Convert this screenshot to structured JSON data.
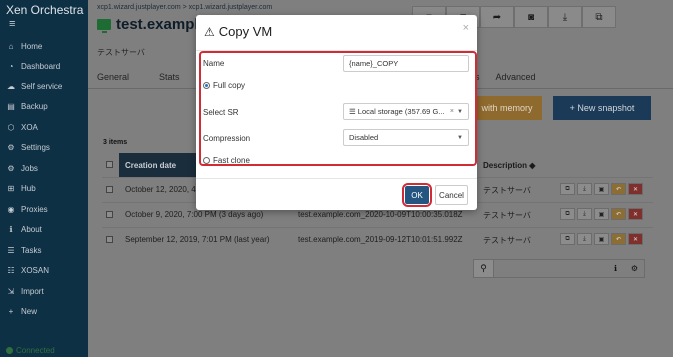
{
  "sidebar": {
    "brand": "Xen Orchestra",
    "menu_icon": "hamburger-icon",
    "items": [
      {
        "label": "Home",
        "icon": "home-icon",
        "glyph": "⌂"
      },
      {
        "label": "Dashboard",
        "icon": "dashboard-icon",
        "glyph": "◔"
      },
      {
        "label": "Self service",
        "icon": "cloud-icon",
        "glyph": "☁"
      },
      {
        "label": "Backup",
        "icon": "backup-icon",
        "glyph": "▤"
      },
      {
        "label": "XOA",
        "icon": "xoa-icon",
        "glyph": "⬡"
      },
      {
        "label": "Settings",
        "icon": "gear-icon",
        "glyph": "⚙"
      },
      {
        "label": "Jobs",
        "icon": "jobs-icon",
        "glyph": "⚙"
      },
      {
        "label": "Hub",
        "icon": "hub-icon",
        "glyph": "⊞"
      },
      {
        "label": "Proxies",
        "icon": "globe-icon",
        "glyph": "◉"
      },
      {
        "label": "About",
        "icon": "info-icon",
        "glyph": "ℹ"
      },
      {
        "label": "Tasks",
        "icon": "tasks-icon",
        "glyph": "☰"
      },
      {
        "label": "XOSAN",
        "icon": "database-icon",
        "glyph": "☷"
      },
      {
        "label": "Import",
        "icon": "import-icon",
        "glyph": "⇲"
      },
      {
        "label": "New",
        "icon": "plus-icon",
        "glyph": "+"
      }
    ],
    "footer": "Connected"
  },
  "header": {
    "breadcrumb": "xcp1.wizard.justplayer.com > xcp1.wizard.justplayer.com",
    "vm_title": "test.example",
    "vm_icon": "desktop-icon",
    "subtitle": "テストサーバ",
    "toolbar": [
      {
        "icon": "stop-icon",
        "glyph": "■"
      },
      {
        "icon": "camera-icon",
        "glyph": "◘"
      },
      {
        "icon": "share-icon",
        "glyph": "➦"
      },
      {
        "icon": "camera-icon",
        "glyph": "◙"
      },
      {
        "icon": "download-icon",
        "glyph": "⤓"
      },
      {
        "icon": "copy-icon",
        "glyph": "⧉"
      }
    ]
  },
  "tabs": {
    "left": [
      "General",
      "Stats"
    ],
    "right": [
      "gs",
      "Advanced"
    ]
  },
  "actions": {
    "with_memory": "with memory",
    "new_snapshot": "+ New snapshot"
  },
  "snapshots": {
    "count_label": "3 items",
    "col_date": "Creation date",
    "col_description": "Description ◆",
    "rows": [
      {
        "date": "October 12, 2020, 4:3",
        "name": "",
        "description": "テストサーバ"
      },
      {
        "date": "October 9, 2020, 7:00 PM (3 days ago)",
        "name": "test.example.com_2020-10-09T10:00:35.018Z",
        "description": "テストサーバ"
      },
      {
        "date": "September 12, 2019, 7:01 PM (last year)",
        "name": "test.example.com_2019-09-12T10:01:51.992Z",
        "description": "テストサーバ"
      }
    ],
    "row_actions": [
      {
        "icon": "copy-icon",
        "glyph": "⧉"
      },
      {
        "icon": "export-icon",
        "glyph": "⤓"
      },
      {
        "icon": "duplicate-icon",
        "glyph": "▣"
      },
      {
        "icon": "revert-icon",
        "glyph": "↶"
      },
      {
        "icon": "delete-icon",
        "glyph": "✕"
      }
    ],
    "search_icon": "search-icon",
    "info_icon": "info-icon",
    "settings_icon": "gear-icon"
  },
  "modal": {
    "title": "Copy VM",
    "title_icon": "warning-icon",
    "close": "×",
    "name_label": "Name",
    "name_value": "{name}_COPY",
    "full_copy_label": "Full copy",
    "sr_label": "Select SR",
    "sr_value": "☰ Local storage (357.69 G...",
    "compression_label": "Compression",
    "compression_value": "Disabled",
    "fast_clone_label": "Fast clone",
    "ok_label": "OK",
    "cancel_label": "Cancel"
  },
  "colors": {
    "sidebar_bg": "#0e3045",
    "primary": "#245580",
    "highlight": "#d12b36"
  }
}
